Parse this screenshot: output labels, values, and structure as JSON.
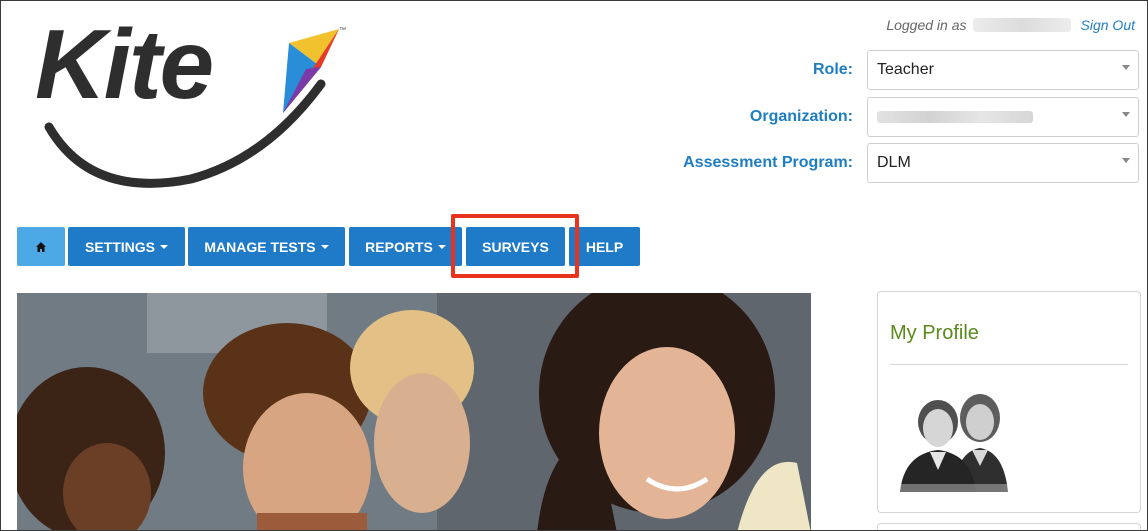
{
  "app": {
    "logo_text": "Kite",
    "trademark": "™"
  },
  "header": {
    "logged_in_label": "Logged in as",
    "sign_out": "Sign Out"
  },
  "selectors": {
    "role": {
      "label": "Role:",
      "value": "Teacher"
    },
    "organization": {
      "label": "Organization:",
      "value": ""
    },
    "program": {
      "label": "Assessment Program:",
      "value": "DLM"
    }
  },
  "nav": {
    "items": [
      {
        "label": "",
        "icon": "home-icon"
      },
      {
        "label": "SETTINGS",
        "dropdown": true
      },
      {
        "label": "MANAGE TESTS",
        "dropdown": true
      },
      {
        "label": "REPORTS",
        "dropdown": true
      },
      {
        "label": "SURVEYS",
        "dropdown": false
      },
      {
        "label": "HELP",
        "dropdown": false
      }
    ],
    "highlighted": "SURVEYS",
    "highlight_color": "#e8341c"
  },
  "profile": {
    "title": "My Profile",
    "icon": "users-icon"
  },
  "colors": {
    "nav_blue": "#1f7bc7",
    "home_blue": "#4da9e6",
    "label_blue": "#1e7ec1",
    "profile_green": "#5a8a1c"
  }
}
